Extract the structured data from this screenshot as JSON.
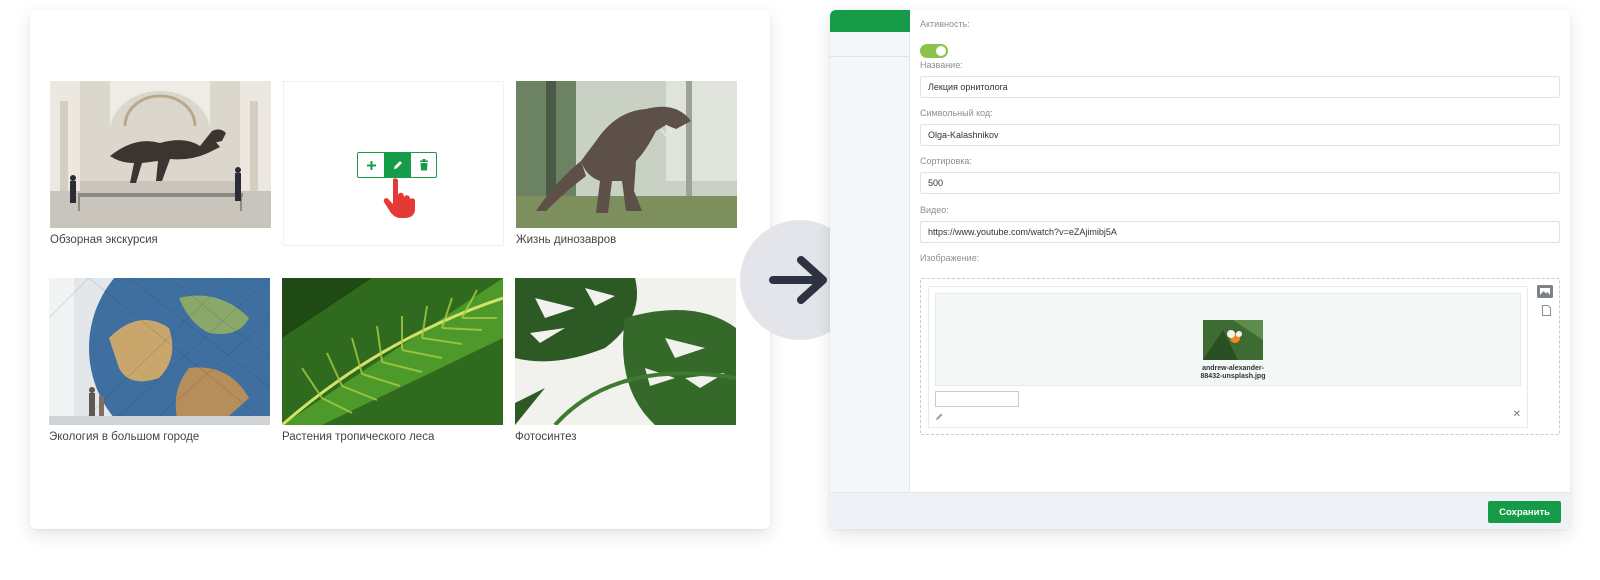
{
  "gallery": {
    "items": [
      {
        "caption": "Обзорная экскурсия",
        "image": "museum-dinosaur-skeleton"
      },
      {
        "caption": "",
        "image": "empty-slot"
      },
      {
        "caption": "Жизнь динозавров",
        "image": "t-rex-in-forest"
      },
      {
        "caption": "Экология в большом городе",
        "image": "globe-sculpture"
      },
      {
        "caption": "Растения тропического леса",
        "image": "tropical-leaf"
      },
      {
        "caption": "Фотосинтез",
        "image": "monstera-leaves"
      }
    ],
    "tools": [
      "plus-icon",
      "pencil-icon",
      "trash-icon"
    ]
  },
  "arrow": {
    "icon": "arrow-right-icon"
  },
  "form": {
    "activity": {
      "label": "Активность:",
      "enabled": true
    },
    "name": {
      "label": "Название:",
      "value": "Лекция орнитолога"
    },
    "code": {
      "label": "Символьный код:",
      "value": "Olga-Kalashnikov"
    },
    "sort": {
      "label": "Сортировка:",
      "value": "500"
    },
    "video": {
      "label": "Видео:",
      "value": "https://www.youtube.com/watch?v=eZAjimibj5A"
    },
    "image": {
      "label": "Изображение:",
      "filename_line1": "andrew-alexander-",
      "filename_line2": "88432-unsplash.jpg"
    },
    "save_label": "Сохранить"
  },
  "colors": {
    "accent": "#169c49",
    "toggle": "#8bc34a",
    "arrow_bg": "#e3e5ea",
    "arrow_fg": "#2d3340"
  }
}
